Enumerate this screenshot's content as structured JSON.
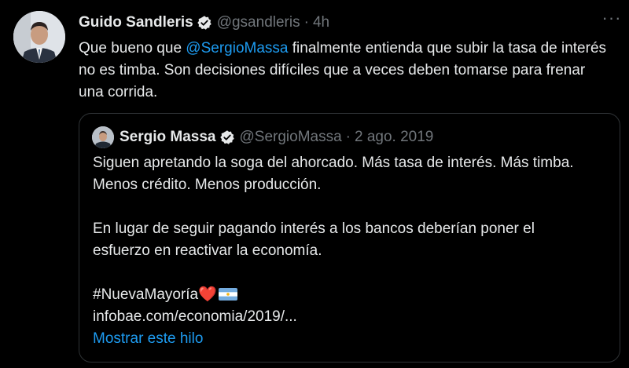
{
  "tweet": {
    "author_name": "Guido Sandleris",
    "author_handle": "@gsandleris",
    "separator": "·",
    "time": "4h",
    "more_label": "···",
    "text_before": "Que bueno que ",
    "mention": "@SergioMassa",
    "text_after": " finalmente entienda que subir la tasa de interés no es timba. Son decisiones difíciles que a veces deben tomarse para frenar una corrida."
  },
  "quote": {
    "author_name": "Sergio Massa",
    "author_handle": "@SergioMassa",
    "separator": "·",
    "date": "2 ago. 2019",
    "paragraph1": "Siguen apretando la soga del ahorcado. Más tasa de interés. Más timba. Menos crédito. Menos producción.",
    "paragraph2": "En lugar de seguir pagando interés a los bancos deberían poner el esfuerzo en reactivar la economía.",
    "hashtag": "#NuevaMayoría",
    "heart": "❤️",
    "flag_icon": "argentina-flag-icon",
    "link": "infobae.com/economia/2019/...",
    "show_thread": "Mostrar este hilo"
  },
  "colors": {
    "background": "#000000",
    "text": "#e7e9ea",
    "secondary": "#71767b",
    "link": "#1d9bf0",
    "border": "#2f3336"
  }
}
